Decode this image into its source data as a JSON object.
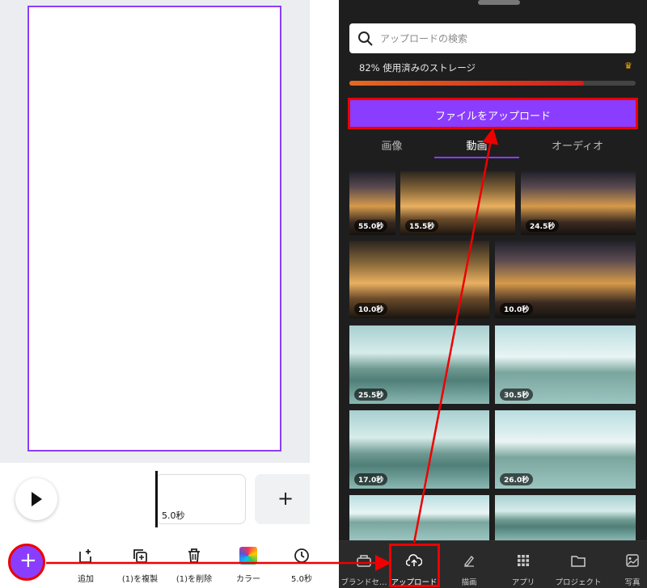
{
  "editor": {
    "clip_duration": "5.0秒",
    "add_clip_symbol": "+",
    "fab_symbol": "+",
    "tools": [
      {
        "label": "追加",
        "icon": "add-page-icon"
      },
      {
        "label": "(1)を複製",
        "icon": "duplicate-icon"
      },
      {
        "label": "(1)を削除",
        "icon": "trash-icon"
      },
      {
        "label": "カラー",
        "icon": "color-swatch-icon"
      },
      {
        "label": "5.0秒",
        "icon": "clock-icon"
      }
    ]
  },
  "uploads": {
    "search_placeholder": "アップロードの検索",
    "storage_text": "82% 使用済みのストレージ",
    "storage_used": 0.82,
    "upload_button": "ファイルをアップロード",
    "tabs": [
      "画像",
      "動画",
      "オーディオ"
    ],
    "active_tab": "動画",
    "videos": [
      {
        "duration": "55.0秒"
      },
      {
        "duration": "15.5秒"
      },
      {
        "duration": "24.5秒"
      },
      {
        "duration": "10.0秒"
      },
      {
        "duration": "10.0秒"
      },
      {
        "duration": "25.5秒"
      },
      {
        "duration": "30.5秒"
      },
      {
        "duration": "17.0秒"
      },
      {
        "duration": "26.0秒"
      }
    ],
    "nav": [
      {
        "label": "ブランドセ…",
        "icon": "brand-kit-icon"
      },
      {
        "label": "アップロード",
        "icon": "cloud-upload-icon"
      },
      {
        "label": "描画",
        "icon": "draw-icon"
      },
      {
        "label": "アプリ",
        "icon": "apps-grid-icon"
      },
      {
        "label": "プロジェクト",
        "icon": "folder-icon"
      },
      {
        "label": "写真",
        "icon": "image-icon"
      }
    ]
  },
  "colors": {
    "accent": "#8b3dff",
    "highlight": "#ee0000",
    "panel_bg": "#1e1e1e"
  }
}
